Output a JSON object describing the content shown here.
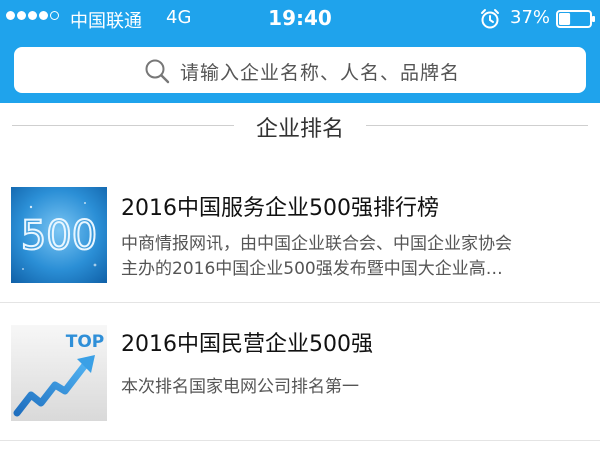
{
  "status_bar": {
    "carrier": "中国联通",
    "network": "4G",
    "time": "19:40",
    "battery": "37%",
    "battery_level": 0.37,
    "signal_bars": 4,
    "signal_bars_total": 5,
    "icons": [
      "alarm-icon",
      "battery-icon"
    ]
  },
  "search": {
    "placeholder": "请输入企业名称、人名、品牌名"
  },
  "section": {
    "title": "企业排名"
  },
  "items": [
    {
      "title": "2016中国服务企业500强排行榜",
      "desc_line1": "中商情报网讯，由中国企业联合会、中国企业家协会",
      "desc_line2": "主办的2016中国企业500强发布暨中国大企业高…",
      "thumb_text": "500"
    },
    {
      "title": "2016中国民营企业500强",
      "desc_line1": "本次排名国家电网公司排名第一",
      "thumb_text": "TOP"
    }
  ],
  "colors": {
    "header": "#1fa3ec",
    "thumb_blue": "#1a7fc8",
    "arrow_blue": "#2f8fd8"
  }
}
